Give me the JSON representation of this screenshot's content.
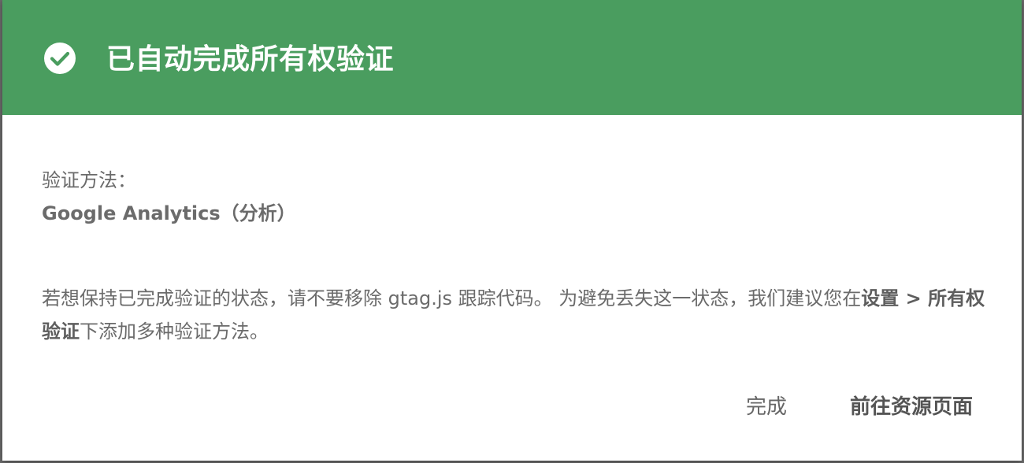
{
  "dialog": {
    "title": "已自动完成所有权验证",
    "header_color": "#4a9d5f",
    "icon": "check-circle-icon",
    "method_label": "验证方法：",
    "method_value": "Google Analytics（分析）",
    "message": {
      "part1": "若想保持已完成验证的状态，请不要移除 gtag.js 跟踪代码。 为避免丢失这一状态，我们建议您在",
      "bold_path": "设置 > 所有权验证",
      "part2": "下添加多种验证方法。"
    },
    "buttons": {
      "done": "完成",
      "go_to_property": "前往资源页面"
    }
  }
}
